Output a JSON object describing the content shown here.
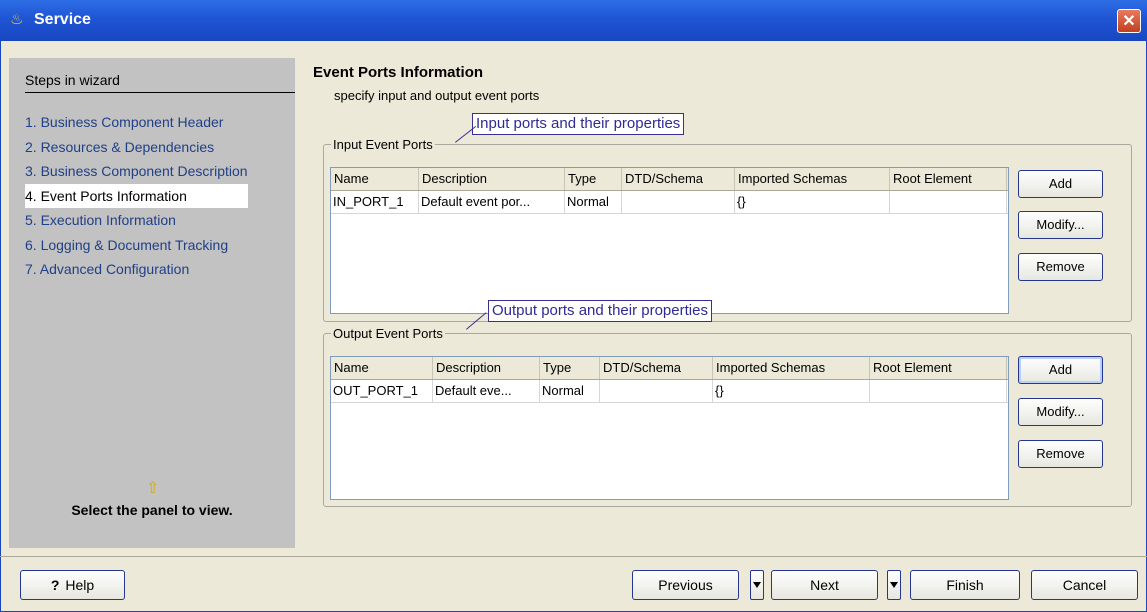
{
  "window": {
    "title": "Service",
    "app_icon": "java-cup-icon",
    "close_glyph": "✕"
  },
  "steps": {
    "heading": "Steps in wizard",
    "items": [
      "1. Business Component Header",
      "2. Resources & Dependencies",
      "3. Business Component Description",
      "4. Event Ports Information",
      "5. Execution Information",
      "6. Logging & Document Tracking",
      "7. Advanced Configuration"
    ],
    "active_index": 3,
    "hint": "Select the panel to view."
  },
  "panel": {
    "title": "Event Ports Information",
    "subtitle": "specify input and output event ports"
  },
  "input_ports": {
    "group_title": "Input Event Ports",
    "callout": "Input ports and their properties",
    "columns": [
      "Name",
      "Description",
      "Type",
      "DTD/Schema",
      "Imported Schemas",
      "Root Element"
    ],
    "rows": [
      [
        "IN_PORT_1",
        "Default event por...",
        "Normal",
        "",
        "{}",
        ""
      ]
    ],
    "buttons": {
      "add": "Add",
      "modify": "Modify...",
      "remove": "Remove"
    }
  },
  "output_ports": {
    "group_title": "Output Event Ports",
    "callout": "Output ports and their properties",
    "columns": [
      "Name",
      "Description",
      "Type",
      "DTD/Schema",
      "Imported Schemas",
      "Root Element"
    ],
    "rows": [
      [
        "OUT_PORT_1",
        "Default eve...",
        "Normal",
        "",
        "{}",
        ""
      ]
    ],
    "buttons": {
      "add": "Add",
      "modify": "Modify...",
      "remove": "Remove"
    }
  },
  "footer": {
    "help": "Help",
    "previous": "Previous",
    "next": "Next",
    "finish": "Finish",
    "cancel": "Cancel"
  }
}
